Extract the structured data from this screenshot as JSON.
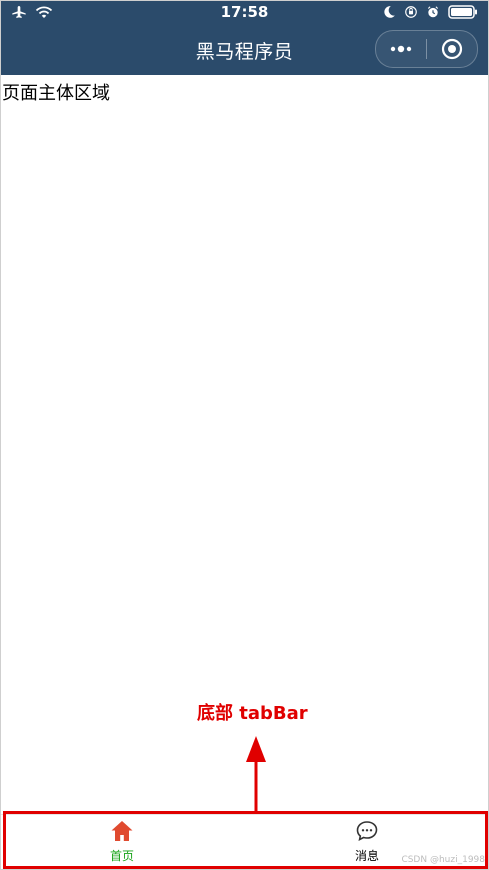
{
  "status_bar": {
    "time": "17:58",
    "icons": [
      "airplane-icon",
      "wifi-icon",
      "moon-icon",
      "orientation-lock-icon",
      "alarm-icon",
      "battery-icon"
    ]
  },
  "nav": {
    "title": "黑马程序员",
    "capsule": {
      "more_icon": "more-icon",
      "target_icon": "target-icon"
    }
  },
  "main": {
    "text": "页面主体区域"
  },
  "annotation": {
    "label": "底部 tabBar",
    "color": "#e00000"
  },
  "tabbar": {
    "items": [
      {
        "label": "首页",
        "icon": "home-icon",
        "active": true,
        "color": "#17a317",
        "icon_color": "#e04a2f"
      },
      {
        "label": "消息",
        "icon": "message-icon",
        "active": false,
        "color": "#000000"
      }
    ]
  },
  "watermark": "CSDN @huzi_1998",
  "colors": {
    "topbar": "#2b4b6b",
    "annotation": "#e00000",
    "tab_active": "#17a317"
  }
}
